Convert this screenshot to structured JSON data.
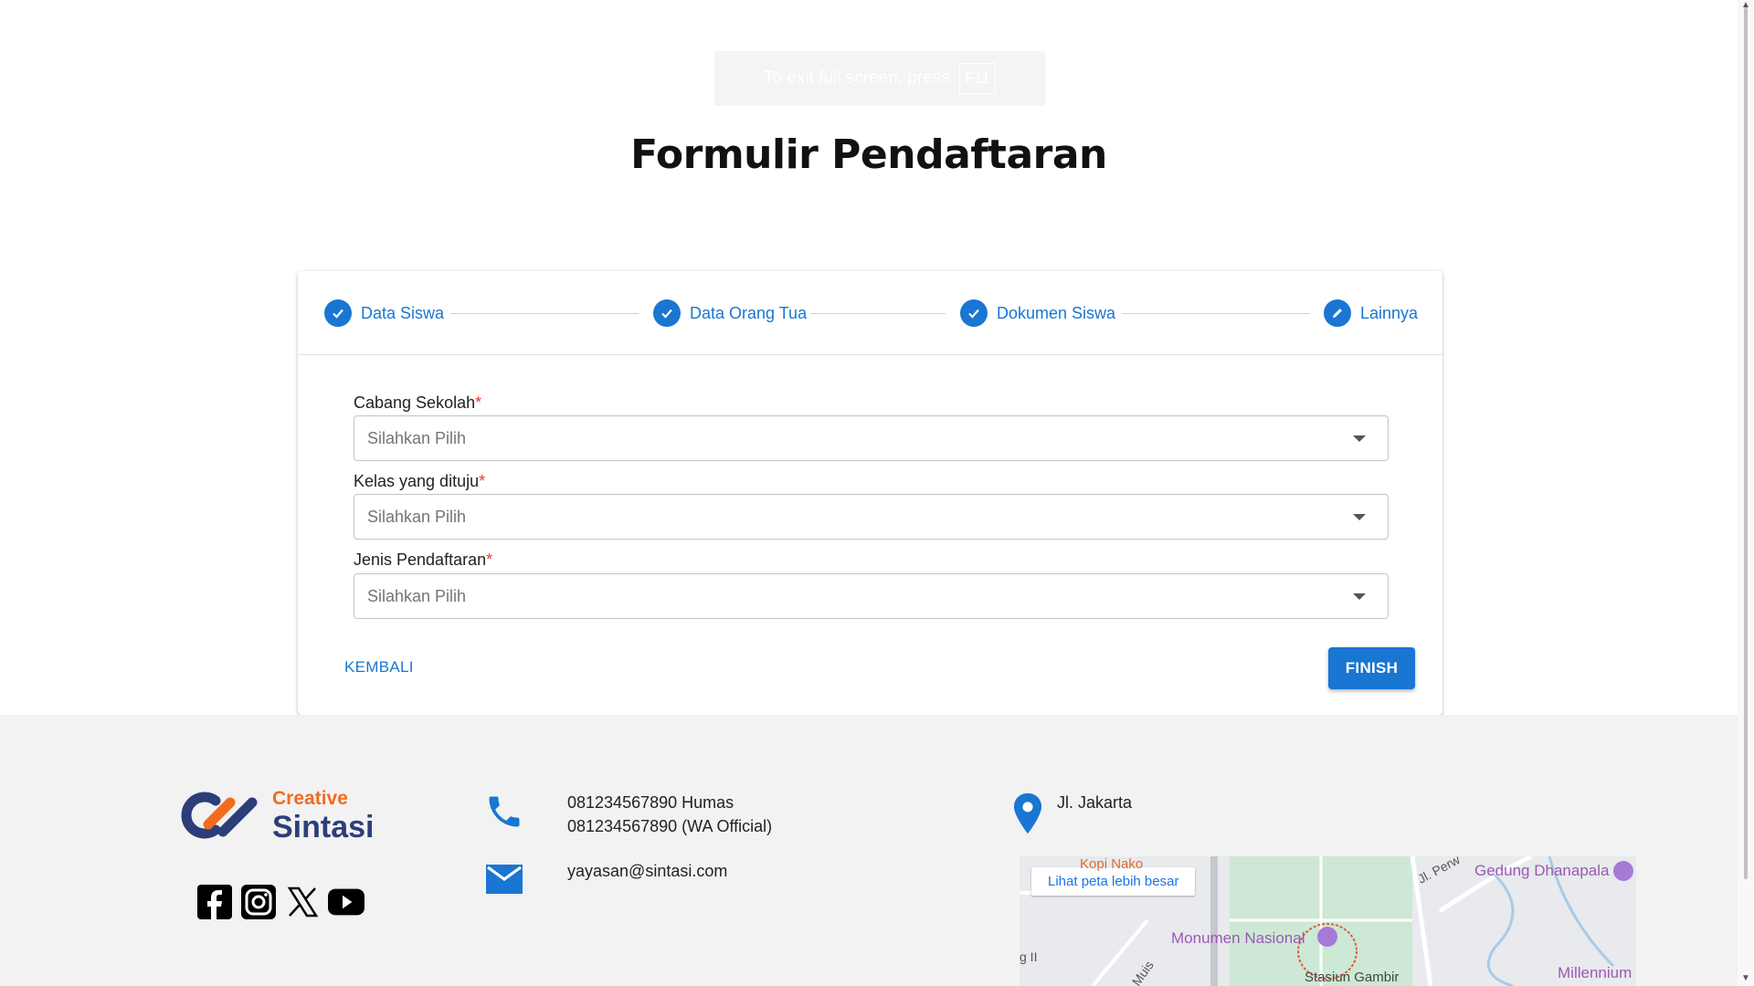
{
  "fullscreen_toast": {
    "text": "To exit full screen, press",
    "key": "F11"
  },
  "page_title": "Formulir Pendaftaran",
  "stepper": {
    "steps": [
      {
        "label": "Data Siswa",
        "state": "completed",
        "icon": "check-icon"
      },
      {
        "label": "Data Orang Tua",
        "state": "completed",
        "icon": "check-icon"
      },
      {
        "label": "Dokumen Siswa",
        "state": "completed",
        "icon": "check-icon"
      },
      {
        "label": "Lainnya",
        "state": "active",
        "icon": "pencil-icon"
      }
    ]
  },
  "form": {
    "fields": [
      {
        "label": "Cabang Sekolah",
        "required_mark": "*",
        "placeholder": "Silahkan Pilih"
      },
      {
        "label": "Kelas yang dituju",
        "required_mark": "*",
        "placeholder": "Silahkan Pilih"
      },
      {
        "label": "Jenis Pendaftaran",
        "required_mark": "*",
        "placeholder": "Silahkan Pilih"
      }
    ],
    "back_label": "KEMBALI",
    "finish_label": "FINISH"
  },
  "footer": {
    "logo": {
      "line1": "Creative",
      "line2": "Sintasi"
    },
    "socials": [
      "facebook-icon",
      "instagram-icon",
      "x-icon",
      "youtube-icon"
    ],
    "phone_lines": [
      "081234567890 Humas",
      "081234567890 (WA Official)"
    ],
    "email": "yayasan@sintasi.com",
    "address": "Jl. Jakarta",
    "map": {
      "button": "Lihat peta lebih besar",
      "labels": [
        "Kopi Nako",
        "Gedung Dhanapala",
        "Monumen Nasional",
        "Millennium",
        "Stasiun Gambir",
        "Jl. Perw",
        "Muis",
        "g II"
      ]
    }
  },
  "colors": {
    "primary": "#1976d2",
    "required": "#e53935",
    "footer_bg": "#f2f2f2",
    "logo_orange": "#f26b21",
    "logo_navy": "#2c3e7a"
  }
}
